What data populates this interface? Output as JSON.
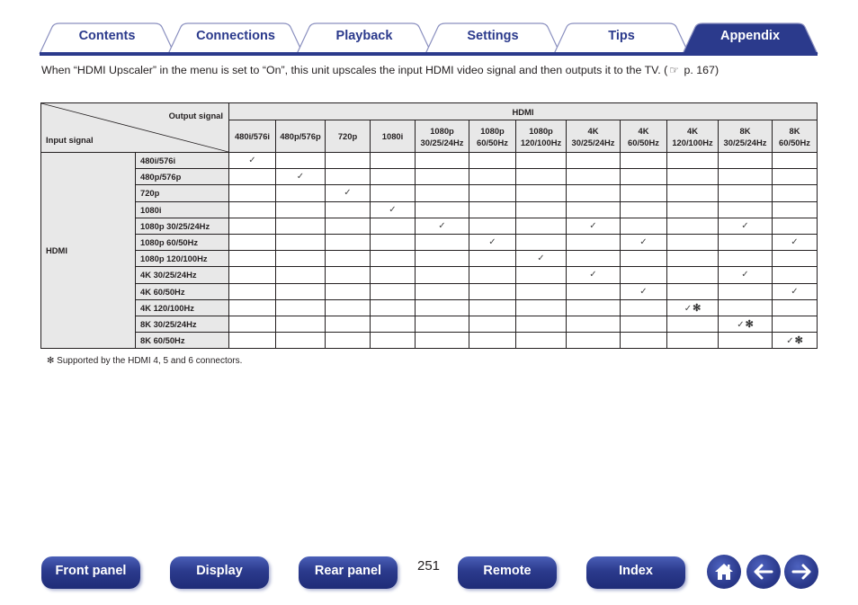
{
  "tabs": [
    {
      "label": "Contents",
      "active": false
    },
    {
      "label": "Connections",
      "active": false
    },
    {
      "label": "Playback",
      "active": false
    },
    {
      "label": "Settings",
      "active": false
    },
    {
      "label": "Tips",
      "active": false
    },
    {
      "label": "Appendix",
      "active": true
    }
  ],
  "colors": {
    "brand": "#2b3a8c",
    "header_bg": "#e8e8e8"
  },
  "intro": {
    "text": "When “HDMI Upscaler” in the menu is set to “On”, this unit upscales the input HDMI video signal and then outputs it to the TV. (",
    "ref_icon": "pointing-hand-icon",
    "ref_glyph": "☞",
    "ref_page": " p. 167)"
  },
  "table": {
    "corner_output": "Output signal",
    "corner_input": "Input signal",
    "output_group": "HDMI",
    "input_group": "HDMI",
    "columns": [
      {
        "line1": "480i/576i",
        "line2": ""
      },
      {
        "line1": "480p/576p",
        "line2": ""
      },
      {
        "line1": "720p",
        "line2": ""
      },
      {
        "line1": "1080i",
        "line2": ""
      },
      {
        "line1": "1080p",
        "line2": "30/25/24Hz"
      },
      {
        "line1": "1080p",
        "line2": "60/50Hz"
      },
      {
        "line1": "1080p",
        "line2": "120/100Hz"
      },
      {
        "line1": "4K",
        "line2": "30/25/24Hz"
      },
      {
        "line1": "4K",
        "line2": "60/50Hz"
      },
      {
        "line1": "4K",
        "line2": "120/100Hz"
      },
      {
        "line1": "8K",
        "line2": "30/25/24Hz"
      },
      {
        "line1": "8K",
        "line2": "60/50Hz"
      }
    ],
    "check_glyph": "✓",
    "asterisk_glyph": "✻",
    "rows": [
      {
        "label": "480i/576i",
        "cells": [
          "✓",
          "",
          "",
          "",
          "",
          "",
          "",
          "",
          "",
          "",
          "",
          ""
        ]
      },
      {
        "label": "480p/576p",
        "cells": [
          "",
          "✓",
          "",
          "",
          "",
          "",
          "",
          "",
          "",
          "",
          "",
          ""
        ]
      },
      {
        "label": "720p",
        "cells": [
          "",
          "",
          "✓",
          "",
          "",
          "",
          "",
          "",
          "",
          "",
          "",
          ""
        ]
      },
      {
        "label": "1080i",
        "cells": [
          "",
          "",
          "",
          "✓",
          "",
          "",
          "",
          "",
          "",
          "",
          "",
          ""
        ]
      },
      {
        "label": "1080p 30/25/24Hz",
        "cells": [
          "",
          "",
          "",
          "",
          "✓",
          "",
          "",
          "✓",
          "",
          "",
          "✓",
          ""
        ]
      },
      {
        "label": "1080p 60/50Hz",
        "cells": [
          "",
          "",
          "",
          "",
          "",
          "✓",
          "",
          "",
          "✓",
          "",
          "",
          "✓"
        ]
      },
      {
        "label": "1080p 120/100Hz",
        "cells": [
          "",
          "",
          "",
          "",
          "",
          "",
          "✓",
          "",
          "",
          "",
          "",
          ""
        ]
      },
      {
        "label": "4K 30/25/24Hz",
        "cells": [
          "",
          "",
          "",
          "",
          "",
          "",
          "",
          "✓",
          "",
          "",
          "✓",
          ""
        ]
      },
      {
        "label": "4K 60/50Hz",
        "cells": [
          "",
          "",
          "",
          "",
          "",
          "",
          "",
          "",
          "✓",
          "",
          "",
          "✓"
        ]
      },
      {
        "label": "4K 120/100Hz",
        "cells": [
          "",
          "",
          "",
          "",
          "",
          "",
          "",
          "",
          "",
          "✓*",
          "",
          ""
        ]
      },
      {
        "label": "8K 30/25/24Hz",
        "cells": [
          "",
          "",
          "",
          "",
          "",
          "",
          "",
          "",
          "",
          "",
          "✓*",
          ""
        ]
      },
      {
        "label": "8K 60/50Hz",
        "cells": [
          "",
          "",
          "",
          "",
          "",
          "",
          "",
          "",
          "",
          "",
          "",
          "✓*"
        ]
      }
    ]
  },
  "footnote": "✻ Supported by the HDMI 4, 5 and 6 connectors.",
  "footer": {
    "buttons": [
      "Front panel",
      "Display",
      "Rear panel",
      "Remote",
      "Index"
    ],
    "page_number": "251",
    "icons": [
      "home-icon",
      "back-arrow-icon",
      "forward-arrow-icon"
    ]
  }
}
